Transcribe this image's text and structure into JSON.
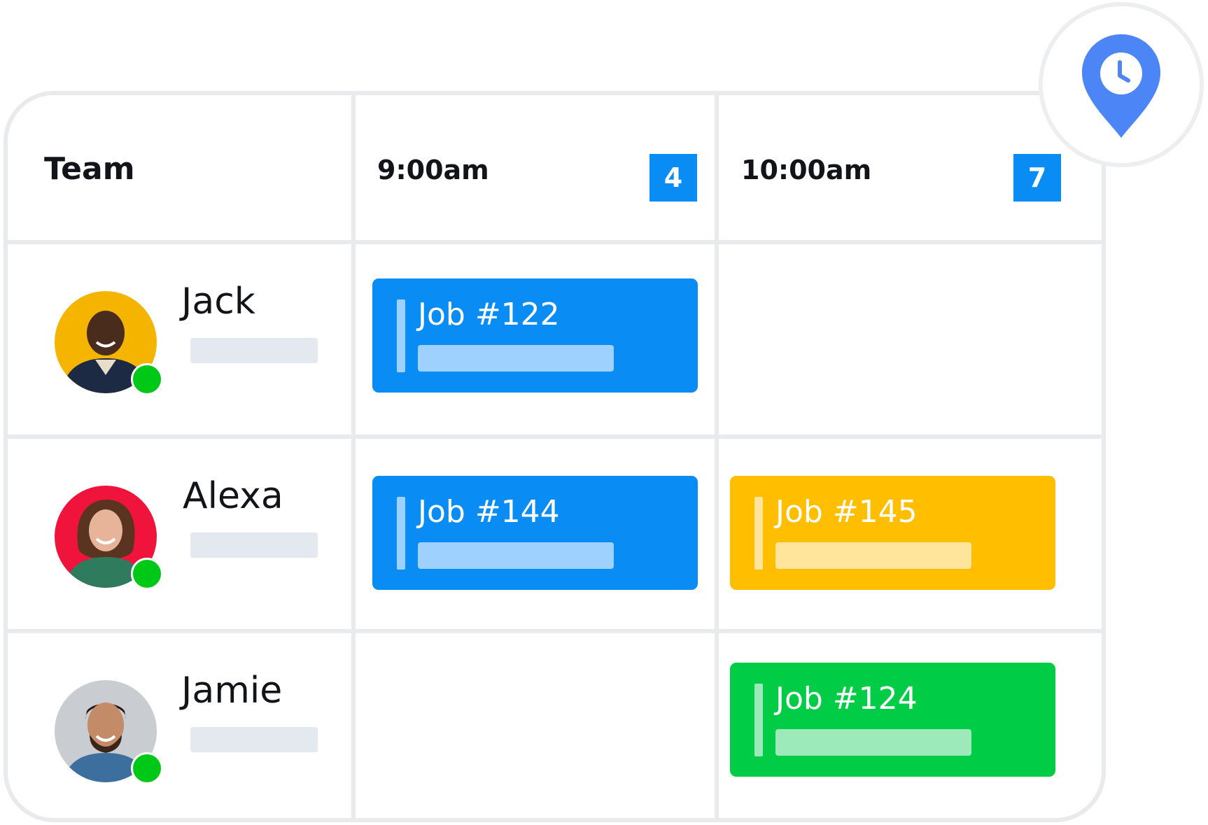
{
  "header": {
    "team_label": "Team",
    "slots": [
      {
        "time": "9:00am",
        "count": "4"
      },
      {
        "time": "10:00am",
        "count": "7"
      }
    ]
  },
  "members": [
    {
      "name": "Jack",
      "avatar_color": "#f4b400",
      "status": "online"
    },
    {
      "name": "Alexa",
      "avatar_color": "#f0133c",
      "status": "online"
    },
    {
      "name": "Jamie",
      "avatar_color": "#c9ccd0",
      "status": "online"
    }
  ],
  "jobs": [
    {
      "label": "Job #122",
      "member": "Jack",
      "slot": "9:00am",
      "color": "#0a8cf5"
    },
    {
      "label": "Job #144",
      "member": "Alexa",
      "slot": "9:00am",
      "color": "#0a8cf5"
    },
    {
      "label": "Job #145",
      "member": "Alexa",
      "slot": "10:00am",
      "color": "#ffbe00"
    },
    {
      "label": "Job #124",
      "member": "Jamie",
      "slot": "10:00am",
      "color": "#00cc46"
    }
  ],
  "colors": {
    "badge": "#0a8cf5",
    "online": "#00c817",
    "grid": "#e9eaec",
    "pin": "#4c85f5"
  },
  "icons": {
    "location_time": "location-clock-icon"
  }
}
